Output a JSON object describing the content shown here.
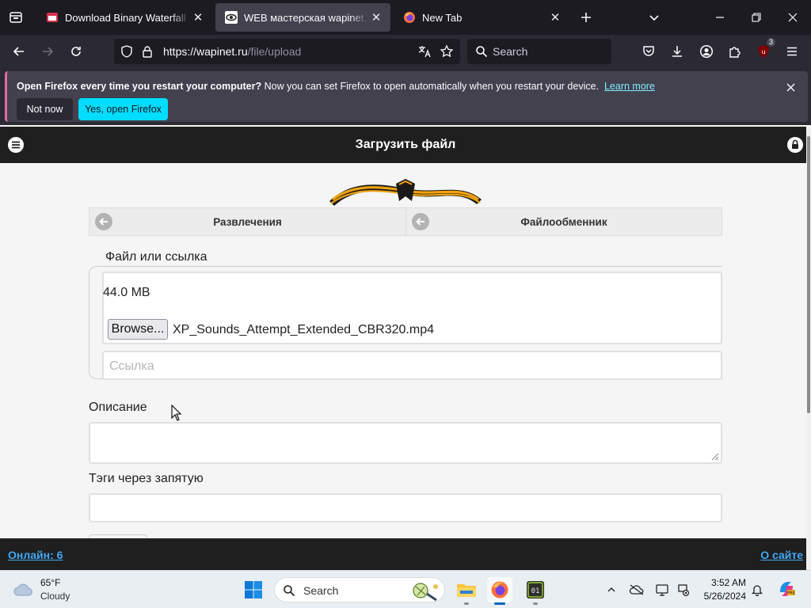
{
  "browser": {
    "tabs": [
      {
        "title": "Download Binary Waterfall (Win",
        "favicon": "red-window-icon",
        "active": false
      },
      {
        "title": "WEB мастерская wapinet.ru - З",
        "favicon": "eye-icon",
        "active": true
      },
      {
        "title": "New Tab",
        "favicon": "firefox-icon",
        "active": false
      }
    ],
    "url_host": "https://wapinet.ru",
    "url_path": "/file/upload",
    "search_placeholder": "Search",
    "extension_badge": "3"
  },
  "notification": {
    "bold_text": "Open Firefox every time you restart your computer?",
    "text": " Now you can set Firefox to open automatically when you restart your device.",
    "link": "Learn more",
    "secondary_button": "Not now",
    "primary_button": "Yes, open Firefox"
  },
  "site": {
    "header_title": "Загрузить файл",
    "breadcrumbs": [
      {
        "label": "Развлечения"
      },
      {
        "label": "Файлообменник"
      }
    ],
    "form": {
      "fieldset_legend": "Файл или ссылка",
      "file_size": "44.0 MB",
      "browse_button": "Browse...",
      "file_name": "XP_Sounds_Attempt_Extended_CBR320.mp4",
      "link_placeholder": "Ссылка",
      "description_label": "Описание",
      "tags_label": "Тэги через запятую"
    },
    "footer": {
      "online": "Онлайн: 6",
      "about": "О сайте"
    }
  },
  "taskbar": {
    "weather_temp": "65°F",
    "weather_desc": "Cloudy",
    "search_text": "Search",
    "time": "3:52 AM",
    "date": "5/26/2024"
  },
  "colors": {
    "accent_button": "#00ddff",
    "link": "#80ebff",
    "footer_link": "#3fa9f5",
    "site_header": "#1f1f1f"
  }
}
